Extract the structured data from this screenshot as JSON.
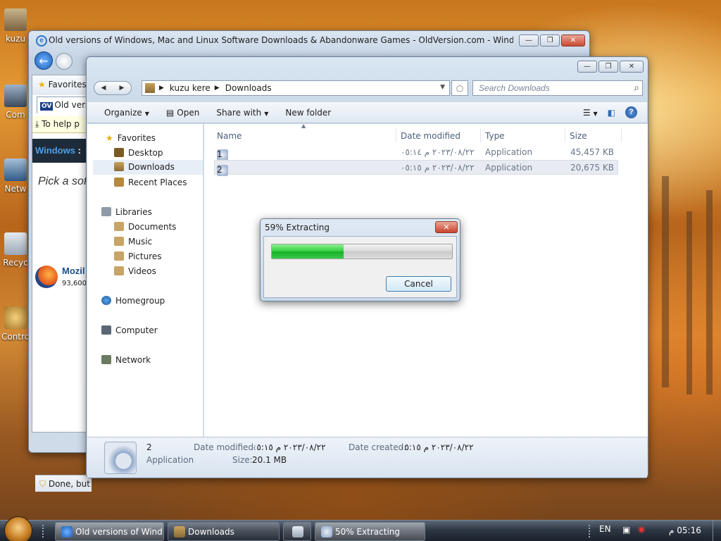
{
  "desktop": {
    "icons": [
      {
        "label": "kuzu",
        "icon": "user-folder-icon"
      },
      {
        "label": "Com",
        "icon": "computer-icon"
      },
      {
        "label": "Netw",
        "icon": "network-icon"
      },
      {
        "label": "Recyc",
        "icon": "recycle-bin-icon"
      },
      {
        "label": "Contro",
        "icon": "control-panel-icon"
      }
    ]
  },
  "ie": {
    "title": "Old versions of Windows, Mac and Linux Software Downloads & Abandonware Games - OldVersion.com - Windows Interne...",
    "favorites": "Favorites",
    "tab_badge": "OV",
    "tab_label": "Old versi",
    "infobar": "To help p",
    "site_header": "Windows",
    "site_header_sep": ":",
    "pick_text": "Pick a sof",
    "firefox_name": "Mozil",
    "firefox_count": "93,600",
    "status": "Done, but"
  },
  "explorer": {
    "breadcrumb": [
      "kuzu kere",
      "Downloads"
    ],
    "search_placeholder": "Search Downloads",
    "toolbar": {
      "organize": "Organize",
      "open": "Open",
      "share_with": "Share with",
      "new_folder": "New folder"
    },
    "nav": {
      "favorites": "Favorites",
      "desktop": "Desktop",
      "downloads": "Downloads",
      "recent_places": "Recent Places",
      "libraries": "Libraries",
      "documents": "Documents",
      "music": "Music",
      "pictures": "Pictures",
      "videos": "Videos",
      "homegroup": "Homegroup",
      "computer": "Computer",
      "network": "Network"
    },
    "columns": {
      "name": "Name",
      "date_modified": "Date modified",
      "type": "Type",
      "size": "Size"
    },
    "files": [
      {
        "name": "1",
        "date": "٢٠٢٣/٠٨/٢٢ م ٠٥:١٤",
        "type": "Application",
        "size": "45,457 KB"
      },
      {
        "name": "2",
        "date": "٢٠٢٣/٠٨/٢٢ م ٠٥:١٥",
        "type": "Application",
        "size": "20,675 KB"
      }
    ],
    "details": {
      "name": "2",
      "type": "Application",
      "date_modified_label": "Date modified:",
      "date_modified": "٢٠٢٣/٠٨/٢٢ م ٠٥:١٥",
      "date_created_label": "Date created:",
      "date_created": "٢٠٢٣/٠٨/٢٢ م ٠٥:١٥",
      "size_label": "Size:",
      "size": "20.1 MB"
    }
  },
  "dialog": {
    "title": "59% Extracting",
    "progress": 0.4,
    "cancel": "Cancel",
    "progress_color": "#2ecf3e"
  },
  "taskbar": {
    "buttons": [
      {
        "label": "Old versions of Wind...",
        "icon": "ie-icon"
      },
      {
        "label": "Downloads",
        "icon": "folder-icon"
      },
      {
        "label": "",
        "icon": "media-icon"
      },
      {
        "label": "50% Extracting",
        "icon": "archive-icon"
      }
    ],
    "lang": "EN",
    "clock": "05:16 م"
  }
}
